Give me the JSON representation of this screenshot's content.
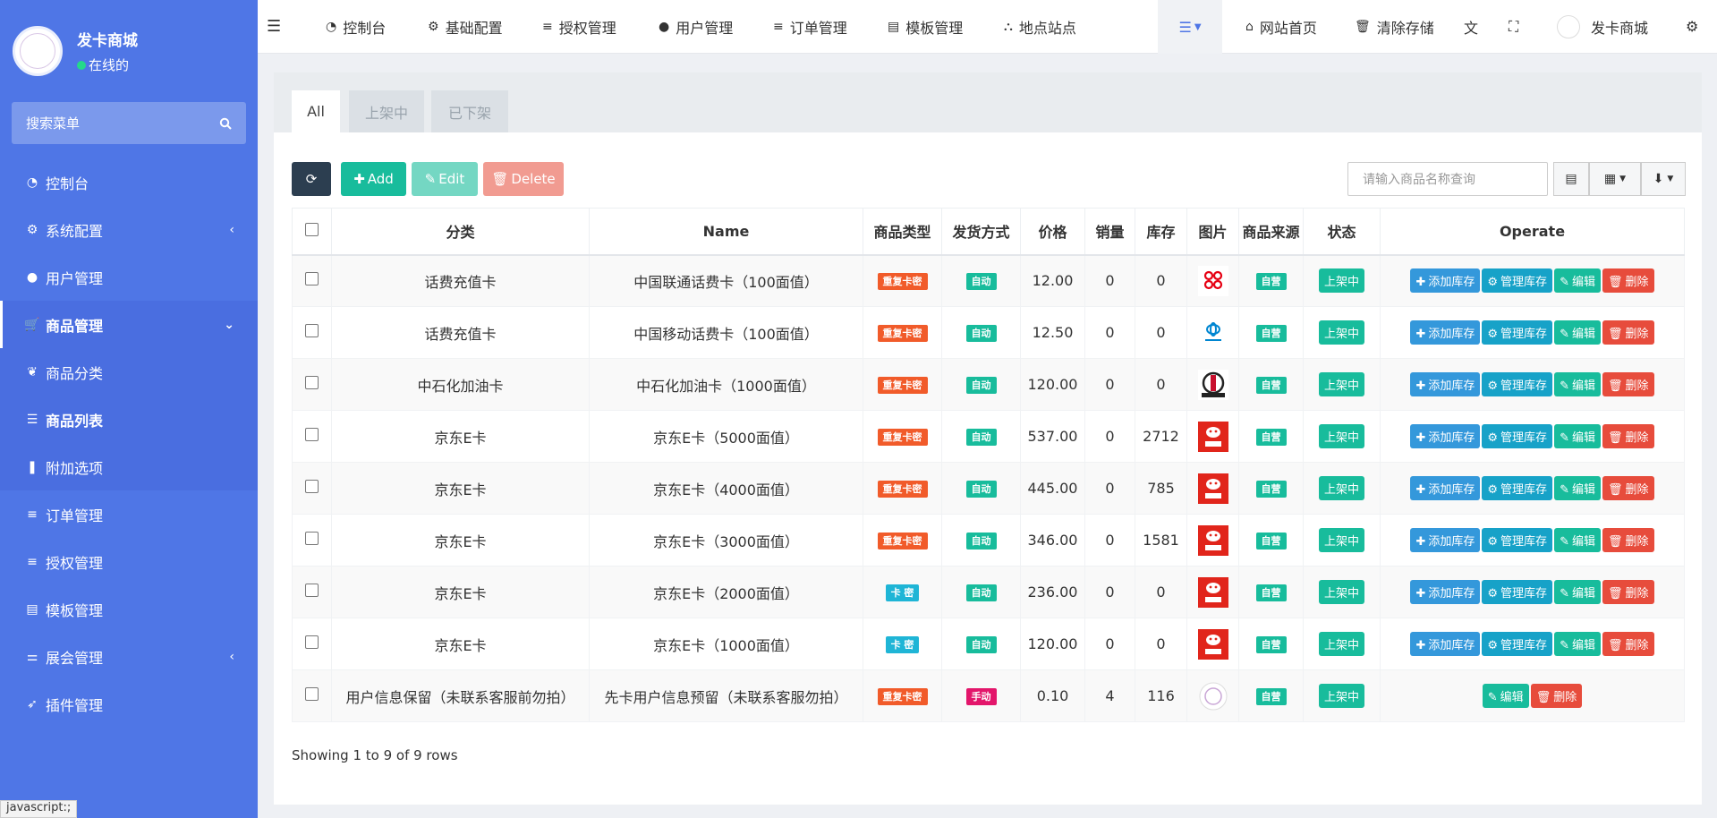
{
  "brand": {
    "name": "发卡商城",
    "status": "在线的"
  },
  "sidebar": {
    "search_placeholder": "搜索菜单",
    "items": [
      {
        "label": "控制台",
        "icon": "dashboard-icon"
      },
      {
        "label": "系统配置",
        "icon": "gear-icon"
      },
      {
        "label": "用户管理",
        "icon": "user-icon"
      },
      {
        "label": "商品管理",
        "icon": "cart-icon"
      },
      {
        "label": "商品分类",
        "icon": "leaf-icon"
      },
      {
        "label": "商品列表",
        "icon": "list-icon"
      },
      {
        "label": "附加选项",
        "icon": "bookmark-icon"
      },
      {
        "label": "订单管理",
        "icon": "bars-icon"
      },
      {
        "label": "授权管理",
        "icon": "bars-icon"
      },
      {
        "label": "模板管理",
        "icon": "list-alt-icon"
      },
      {
        "label": "展会管理",
        "icon": "sliders-icon"
      },
      {
        "label": "插件管理",
        "icon": "rocket-icon"
      }
    ]
  },
  "topbar": {
    "nav": [
      "控制台",
      "基础配置",
      "授权管理",
      "用户管理",
      "订单管理",
      "模板管理",
      "地点站点"
    ],
    "home": "网站首页",
    "clear": "清除存储",
    "user": "发卡商城"
  },
  "tabs": [
    "All",
    "上架中",
    "已下架"
  ],
  "toolbar": {
    "add": "Add",
    "edit": "Edit",
    "delete": "Delete",
    "search_placeholder": "请输入商品名称查询"
  },
  "table": {
    "headers": [
      "分类",
      "Name",
      "商品类型",
      "发货方式",
      "价格",
      "销量",
      "库存",
      "图片",
      "商品来源",
      "状态",
      "Operate"
    ],
    "rows": [
      {
        "cat": "话费充值卡",
        "name": "中国联通话费卡（100面值）",
        "type": "重复卡密",
        "ship": "自动",
        "price": "12.00",
        "sales": "0",
        "stock": "0",
        "pic": "unicom",
        "src": "自营",
        "state": "上架中",
        "ops": [
          "添加库存",
          "管理库存",
          "编辑",
          "删除"
        ]
      },
      {
        "cat": "话费充值卡",
        "name": "中国移动话费卡（100面值）",
        "type": "重复卡密",
        "ship": "自动",
        "price": "12.50",
        "sales": "0",
        "stock": "0",
        "pic": "mobile",
        "src": "自营",
        "state": "上架中",
        "ops": [
          "添加库存",
          "管理库存",
          "编辑",
          "删除"
        ]
      },
      {
        "cat": "中石化加油卡",
        "name": "中石化加油卡（1000面值）",
        "type": "重复卡密",
        "ship": "自动",
        "price": "120.00",
        "sales": "0",
        "stock": "0",
        "pic": "sinopec",
        "src": "自营",
        "state": "上架中",
        "ops": [
          "添加库存",
          "管理库存",
          "编辑",
          "删除"
        ]
      },
      {
        "cat": "京东E卡",
        "name": "京东E卡（5000面值）",
        "type": "重复卡密",
        "ship": "自动",
        "price": "537.00",
        "sales": "0",
        "stock": "2712",
        "pic": "jd",
        "src": "自营",
        "state": "上架中",
        "ops": [
          "添加库存",
          "管理库存",
          "编辑",
          "删除"
        ]
      },
      {
        "cat": "京东E卡",
        "name": "京东E卡（4000面值）",
        "type": "重复卡密",
        "ship": "自动",
        "price": "445.00",
        "sales": "0",
        "stock": "785",
        "pic": "jd",
        "src": "自营",
        "state": "上架中",
        "ops": [
          "添加库存",
          "管理库存",
          "编辑",
          "删除"
        ]
      },
      {
        "cat": "京东E卡",
        "name": "京东E卡（3000面值）",
        "type": "重复卡密",
        "ship": "自动",
        "price": "346.00",
        "sales": "0",
        "stock": "1581",
        "pic": "jd",
        "src": "自营",
        "state": "上架中",
        "ops": [
          "添加库存",
          "管理库存",
          "编辑",
          "删除"
        ]
      },
      {
        "cat": "京东E卡",
        "name": "京东E卡（2000面值）",
        "type": "卡 密",
        "ship": "自动",
        "price": "236.00",
        "sales": "0",
        "stock": "0",
        "pic": "jd",
        "src": "自营",
        "state": "上架中",
        "ops": [
          "添加库存",
          "管理库存",
          "编辑",
          "删除"
        ]
      },
      {
        "cat": "京东E卡",
        "name": "京东E卡（1000面值）",
        "type": "卡 密",
        "ship": "自动",
        "price": "120.00",
        "sales": "0",
        "stock": "0",
        "pic": "jd",
        "src": "自营",
        "state": "上架中",
        "ops": [
          "添加库存",
          "管理库存",
          "编辑",
          "删除"
        ]
      },
      {
        "cat": "用户信息保留（未联系客服前勿拍）",
        "name": "先卡用户信息预留（未联系客服勿拍）",
        "type": "重复卡密",
        "ship": "手动",
        "price": "0.10",
        "sales": "4",
        "stock": "116",
        "pic": "logo",
        "src": "自营",
        "state": "上架中",
        "ops": [
          "编辑",
          "删除"
        ]
      }
    ]
  },
  "footer": {
    "summary": "Showing 1 to 9 of 9 rows"
  },
  "status_bar": "javascript:;",
  "colors": {
    "sidebar": "#4f76e6",
    "primary": "#18bc9c",
    "danger": "#e74c3c",
    "info": "#3498db"
  }
}
